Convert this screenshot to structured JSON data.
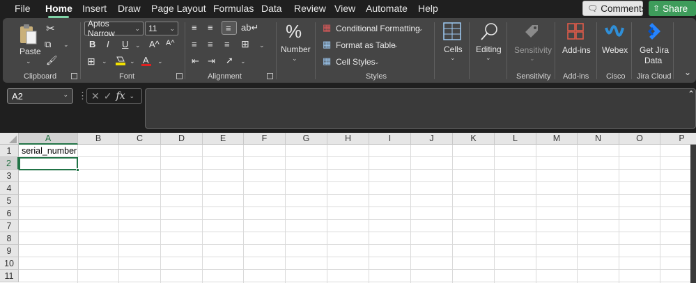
{
  "menubar": {
    "items": [
      "File",
      "Home",
      "Insert",
      "Draw",
      "Page Layout",
      "Formulas",
      "Data",
      "Review",
      "View",
      "Automate",
      "Help"
    ],
    "active": "Home",
    "comments_label": "Comments",
    "share_label": "Share"
  },
  "ribbon": {
    "clipboard": {
      "paste_label": "Paste",
      "group_label": "Clipboard"
    },
    "font": {
      "font_name": "Aptos Narrow",
      "font_size": "11",
      "bold": "B",
      "italic": "I",
      "underline": "U",
      "grow": "A^",
      "shrink": "A^",
      "font_color_glyph": "A",
      "group_label": "Font"
    },
    "alignment": {
      "group_label": "Alignment"
    },
    "number": {
      "glyph": "%",
      "label": "Number"
    },
    "styles": {
      "conditional_formatting": "Conditional Formatting",
      "format_as_table": "Format as Table",
      "cell_styles": "Cell Styles",
      "group_label": "Styles"
    },
    "cells": {
      "label": "Cells"
    },
    "editing": {
      "label": "Editing"
    },
    "sensitivity": {
      "label": "Sensitivity",
      "group_label": "Sensitivity"
    },
    "addins": {
      "label": "Add-ins",
      "group_label": "Add-ins"
    },
    "webex": {
      "label": "Webex",
      "group_label": "Cisco"
    },
    "jira": {
      "label_line1": "Get Jira",
      "label_line2": "Data",
      "group_label": "Jira Cloud"
    }
  },
  "formula_bar": {
    "name_box": "A2",
    "fx_label": "fx",
    "formula_value": ""
  },
  "sheet": {
    "columns": [
      "A",
      "B",
      "C",
      "D",
      "E",
      "F",
      "G",
      "H",
      "I",
      "J",
      "K",
      "L",
      "M",
      "N",
      "O",
      "P"
    ],
    "rows": [
      "1",
      "2",
      "3",
      "4",
      "5",
      "6",
      "7",
      "8",
      "9",
      "10",
      "11"
    ],
    "selected_column": "A",
    "selected_row": "2",
    "cells": {
      "A1": "serial_number"
    }
  },
  "colors": {
    "accent_green": "#217346",
    "share_green": "#3e9c5b",
    "ribbon_bg": "#454545",
    "app_bg": "#1f1f1f"
  }
}
